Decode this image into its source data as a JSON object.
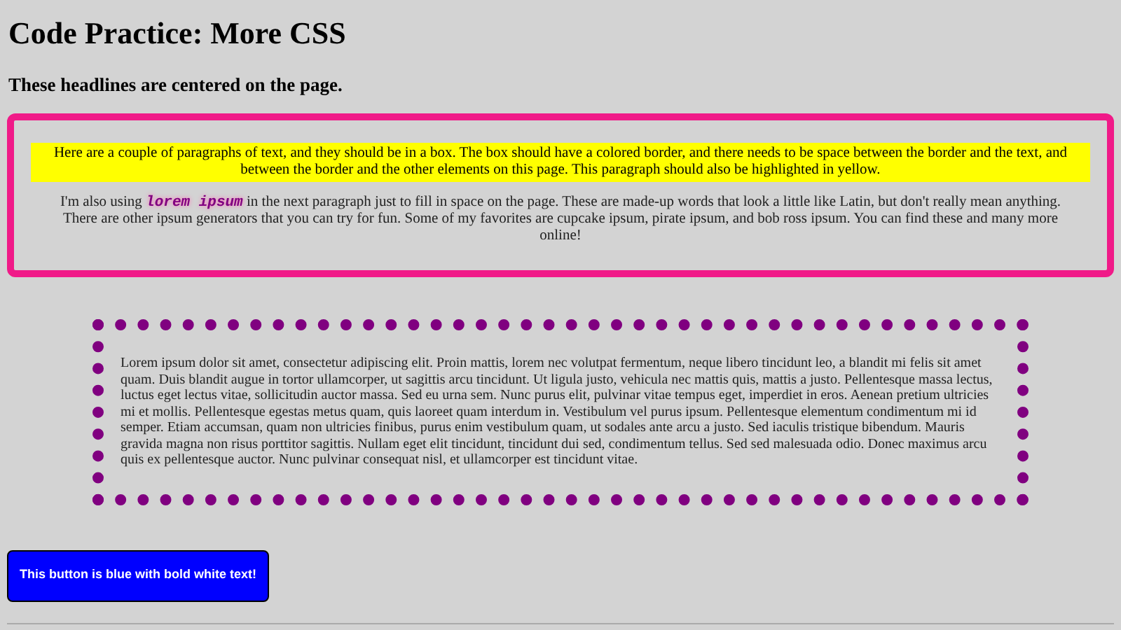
{
  "heading": "Code Practice: More CSS",
  "subheading": "These headlines are centered on the page.",
  "pink_box": {
    "highlighted_paragraph": "Here are a couple of paragraphs of text, and they should be in a box. The box should have a colored border, and there needs to be space between the border and the text, and between the border and the other elements on this page. This paragraph should also be highlighted in yellow.",
    "paragraph": {
      "before": "I'm also using",
      "code": "lorem ipsum",
      "after": "in the next paragraph just to fill in space on the page. These are made-up words that look a little like Latin, but don't really mean anything. There are other ipsum generators that you can try for fun. Some of my favorites are cupcake ipsum, pirate ipsum, and bob ross ipsum. You can find these and many more online!"
    }
  },
  "dotted_box": {
    "paragraph": "Lorem ipsum dolor sit amet, consectetur adipiscing elit. Proin mattis, lorem nec volutpat fermentum, neque libero tincidunt leo, a blandit mi felis sit amet quam. Duis blandit augue in tortor ullamcorper, ut sagittis arcu tincidunt. Ut ligula justo, vehicula nec mattis quis, mattis a justo. Pellentesque massa lectus, luctus eget lectus vitae, sollicitudin auctor massa. Sed eu urna sem. Nunc purus elit, pulvinar vitae tempus eget, imperdiet in eros. Aenean pretium ultricies mi et mollis. Pellentesque egestas metus quam, quis laoreet quam interdum in. Vestibulum vel purus ipsum. Pellentesque elementum condimentum mi id semper. Etiam accumsan, quam non ultricies finibus, purus enim vestibulum quam, ut sodales ante arcu a justo. Sed iaculis tristique bibendum. Mauris gravida magna non risus porttitor sagittis. Nullam eget elit tincidunt, tincidunt dui sed, condimentum tellus. Sed sed malesuada odio. Donec maximus arcu quis ex pellentesque auctor. Nunc pulvinar consequat nisl, et ullamcorper est tincidunt vitae."
  },
  "button": "This button is blue with bold white text!"
}
